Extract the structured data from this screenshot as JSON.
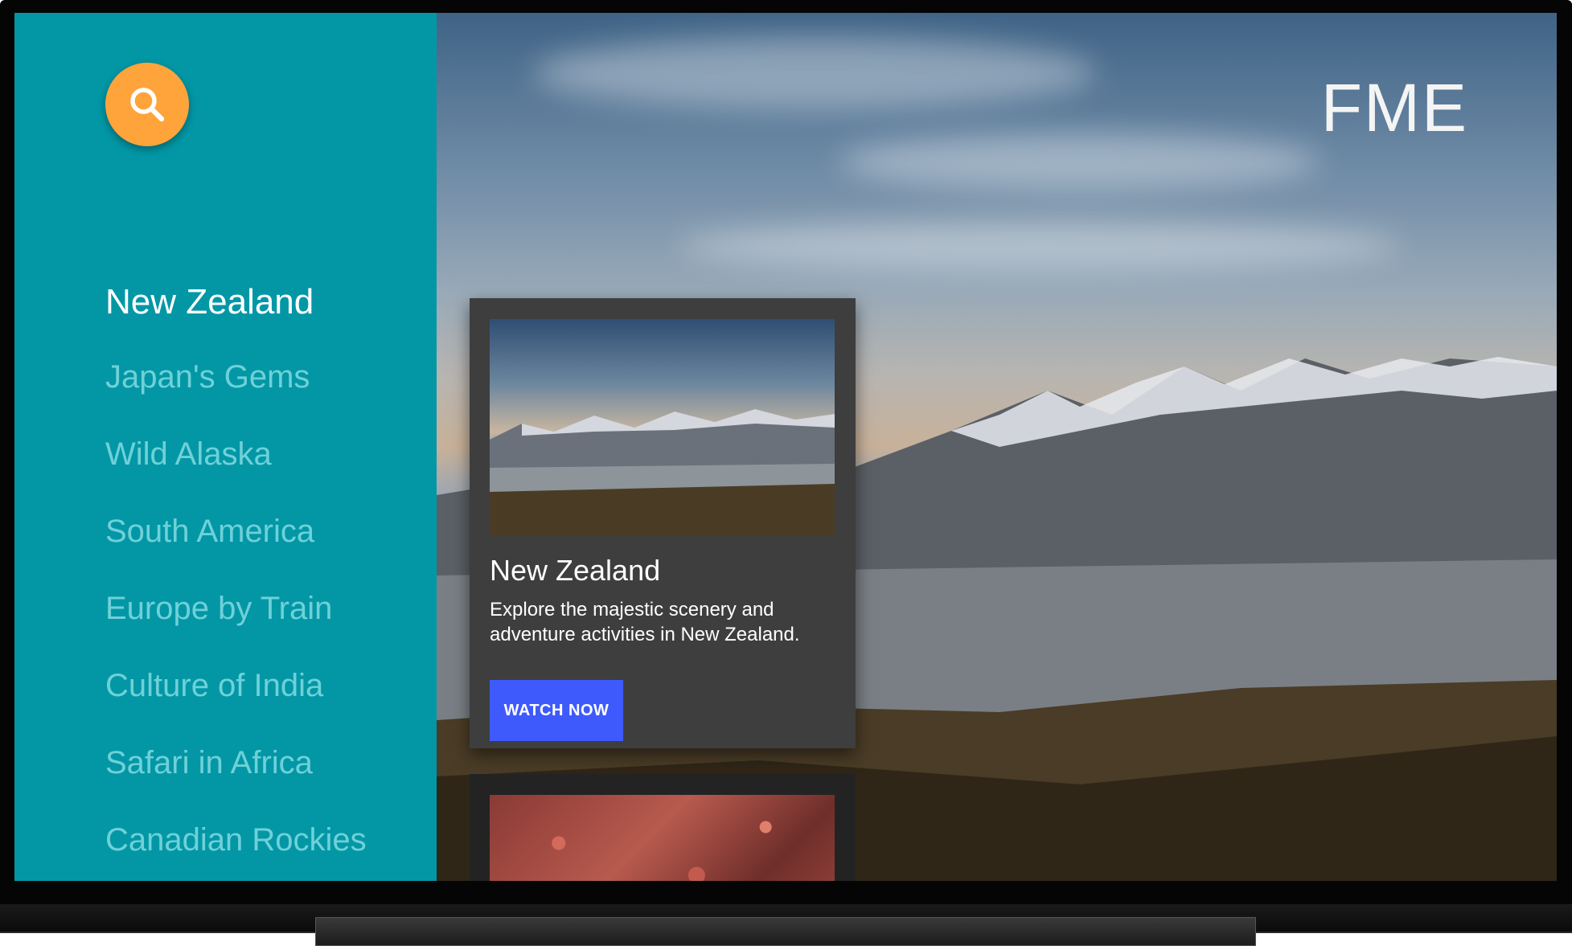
{
  "brand": {
    "title": "FME"
  },
  "search": {
    "icon": "search-icon",
    "color": "#ffa43a"
  },
  "sidebar": {
    "background": "#0397a6",
    "items": [
      {
        "label": "New Zealand",
        "active": true
      },
      {
        "label": "Japan's Gems",
        "active": false
      },
      {
        "label": "Wild Alaska",
        "active": false
      },
      {
        "label": "South America",
        "active": false
      },
      {
        "label": "Europe by Train",
        "active": false
      },
      {
        "label": "Culture of India",
        "active": false
      },
      {
        "label": "Safari in Africa",
        "active": false
      },
      {
        "label": "Canadian Rockies",
        "active": false
      }
    ]
  },
  "featured": {
    "title": "New Zealand",
    "description": "Explore the majestic scenery and adventure activities in New Zealand.",
    "button_label": "WATCH NOW",
    "button_color": "#3e5afd"
  }
}
